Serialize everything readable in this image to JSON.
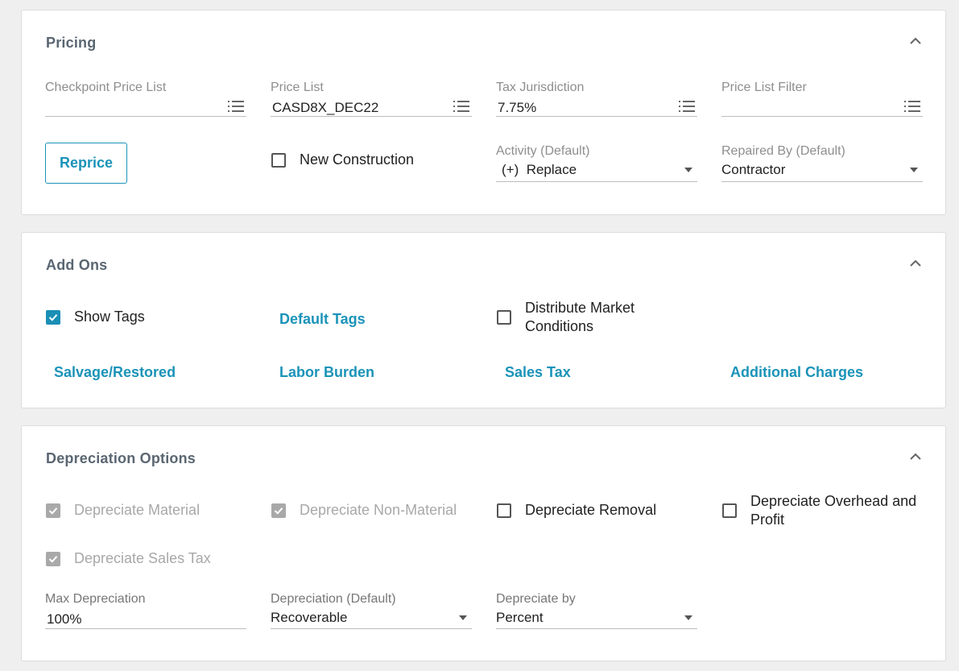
{
  "pricing": {
    "title": "Pricing",
    "checkpoint_price_list": {
      "label": "Checkpoint Price List",
      "value": ""
    },
    "price_list": {
      "label": "Price List",
      "value": "CASD8X_DEC22"
    },
    "tax_jurisdiction": {
      "label": "Tax Jurisdiction",
      "value": "7.75%"
    },
    "price_list_filter": {
      "label": "Price List Filter",
      "value": ""
    },
    "reprice_label": "Reprice",
    "new_construction": {
      "label": "New Construction",
      "checked": false
    },
    "activity": {
      "label": "Activity (Default)",
      "value": "(+)  Replace"
    },
    "repaired_by": {
      "label": "Repaired By (Default)",
      "value": "Contractor"
    }
  },
  "add_ons": {
    "title": "Add Ons",
    "show_tags": {
      "label": "Show Tags",
      "checked": true
    },
    "default_tags": "Default Tags",
    "distribute_market": {
      "label_line1": "Distribute Market",
      "label_line2": "Conditions",
      "checked": false
    },
    "links": {
      "salvage": "Salvage/Restored",
      "labor_burden": "Labor Burden",
      "sales_tax": "Sales Tax",
      "additional_charges": "Additional Charges"
    }
  },
  "depreciation": {
    "title": "Depreciation Options",
    "depreciate_material": {
      "label": "Depreciate Material",
      "checked": true,
      "disabled": true
    },
    "depreciate_non_material": {
      "label": "Depreciate Non-Material",
      "checked": true,
      "disabled": true
    },
    "depreciate_removal": {
      "label": "Depreciate Removal",
      "checked": false
    },
    "depreciate_overhead": {
      "label_line1": "Depreciate Overhead and",
      "label_line2": "Profit",
      "checked": false
    },
    "depreciate_sales_tax": {
      "label": "Depreciate Sales Tax",
      "checked": true,
      "disabled": true
    },
    "max_depreciation": {
      "label": "Max Depreciation",
      "value": "100%"
    },
    "depreciation_default": {
      "label": "Depreciation (Default)",
      "value": "Recoverable"
    },
    "depreciate_by": {
      "label": "Depreciate by",
      "value": "Percent"
    }
  },
  "colors": {
    "accent": "#1b93b8",
    "background": "#efefef",
    "card": "#ffffff",
    "disabled": "#a9a9a9"
  },
  "icons": {
    "collapse": "chevron-up-icon",
    "list": "list-icon",
    "dropdown": "caret-down-icon",
    "check": "check-icon"
  }
}
